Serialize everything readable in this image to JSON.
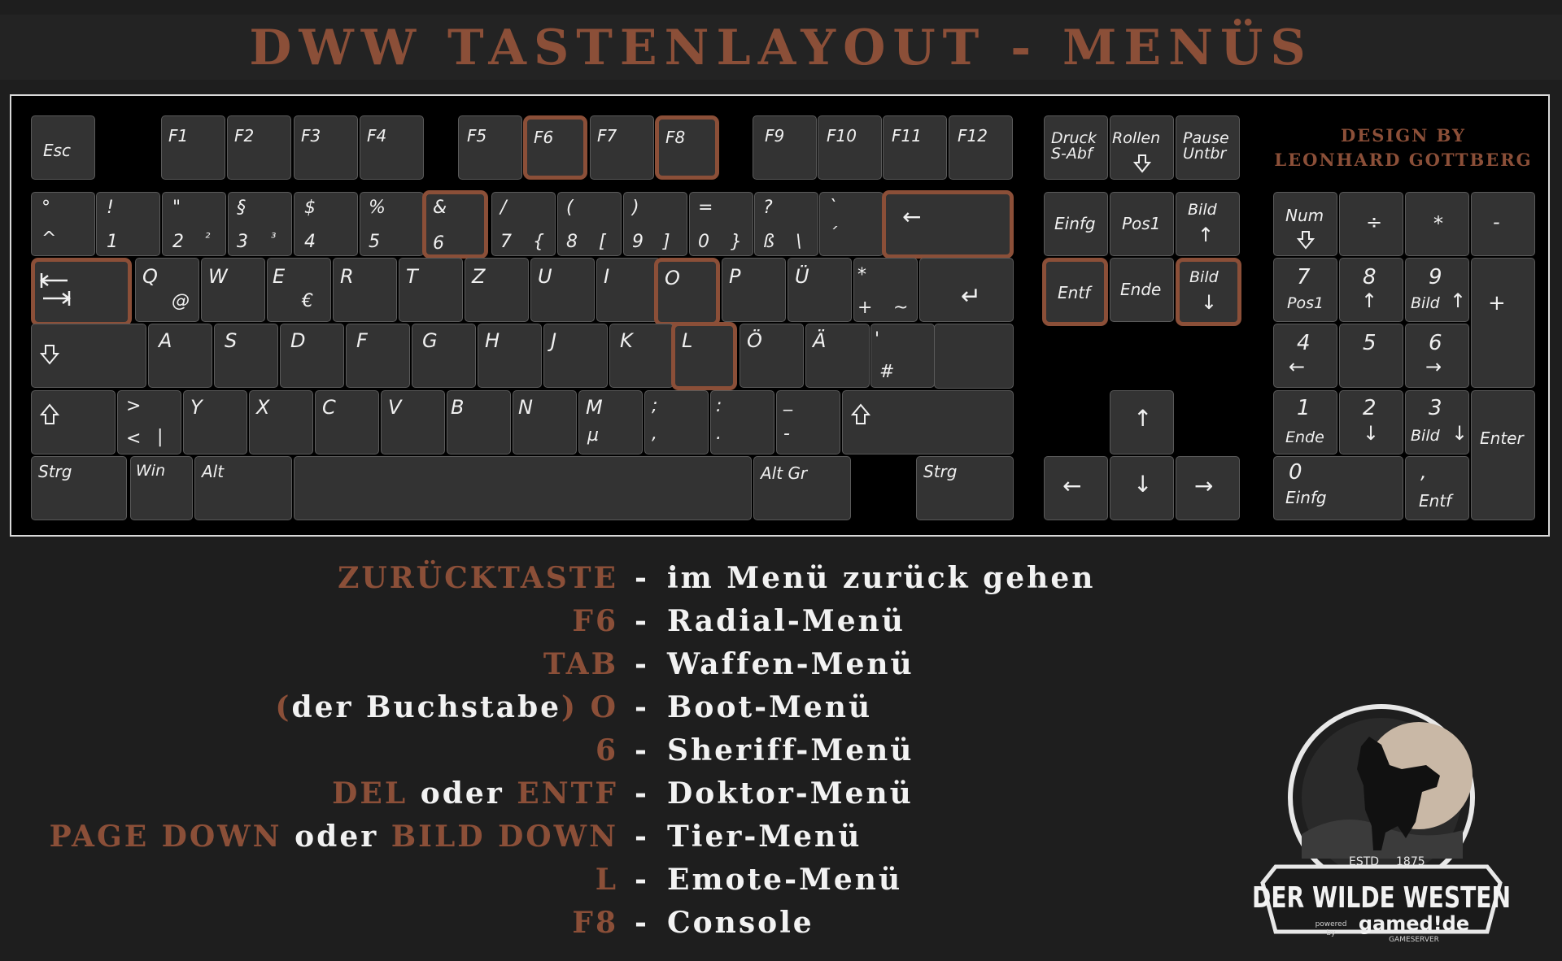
{
  "title": "DWW TASTENLAYOUT - MENÜS",
  "design_by": {
    "line1": "DESIGN BY",
    "line2": "LEONHARD GOTTBERG"
  },
  "colors": {
    "accent": "#8b4f38",
    "key": "#333333",
    "background": "#1e1e1e",
    "text": "#f2f2f2"
  },
  "keys": {
    "esc": "Esc",
    "f1": "F1",
    "f2": "F2",
    "f3": "F3",
    "f4": "F4",
    "f5": "F5",
    "f6": "F6",
    "f7": "F7",
    "f8": "F8",
    "f9": "F9",
    "f10": "F10",
    "f11": "F11",
    "f12": "F12",
    "druck": "Druck\nS-Abf",
    "rollen": "Rollen",
    "pause": "Pause\nUntbr",
    "deg_top": "°",
    "deg_bot": "^",
    "n1_top": "!",
    "n1_bot": "1",
    "n2_top": "\"",
    "n2_bot": "2",
    "n2_alt": "²",
    "n3_top": "§",
    "n3_bot": "3",
    "n3_alt": "³",
    "n4_top": "$",
    "n4_bot": "4",
    "n5_top": "%",
    "n5_bot": "5",
    "n6_top": "&",
    "n6_bot": "6",
    "n7_top": "/",
    "n7_bot": "7",
    "n7_alt": "{",
    "n8_top": "(",
    "n8_bot": "8",
    "n8_alt": "[",
    "n9_top": ")",
    "n9_bot": "9",
    "n9_alt": "]",
    "n0_top": "=",
    "n0_bot": "0",
    "n0_alt": "}",
    "sz_top": "?",
    "sz_bot": "ß",
    "sz_alt": "\\",
    "acc_top": "`",
    "acc_bot": "´",
    "backspace": "←",
    "q": "Q",
    "q_alt": "@",
    "w": "W",
    "e": "E",
    "e_alt": "€",
    "r": "R",
    "t": "T",
    "z": "Z",
    "u": "U",
    "i": "I",
    "o": "O",
    "p": "P",
    "ue": "Ü",
    "plus_top": "*",
    "plus_bot": "+",
    "plus_alt": "~",
    "enter": "↵",
    "a": "A",
    "s": "S",
    "d": "D",
    "f": "F",
    "g": "G",
    "h": "H",
    "j": "J",
    "k": "K",
    "l": "L",
    "oe": "Ö",
    "ae": "Ä",
    "hash_top": "'",
    "hash_bot": "#",
    "lt_top": ">",
    "lt_bot": "<",
    "lt_alt": "|",
    "y": "Y",
    "x": "X",
    "c": "C",
    "v": "V",
    "b": "B",
    "n": "N",
    "m": "M",
    "m_alt": "µ",
    "comma_top": ";",
    "comma_bot": ",",
    "dot_top": ":",
    "dot_bot": ".",
    "minus_top": "_",
    "minus_bot": "-",
    "strg": "Strg",
    "win": "Win",
    "alt": "Alt",
    "altgr": "Alt Gr",
    "strg_r": "Strg",
    "einfg": "Einfg",
    "pos1": "Pos1",
    "bild_up": "Bild",
    "entf": "Entf",
    "ende": "Ende",
    "bild_down": "Bild",
    "arrow_up": "↑",
    "arrow_left": "←",
    "arrow_down": "↓",
    "arrow_right": "→",
    "num": "Num",
    "np_div": "÷",
    "np_mul": "*",
    "np_minus": "-",
    "np_plus": "+",
    "np7": "7",
    "np7_sub": "Pos1",
    "np8": "8",
    "np9": "9",
    "np9_sub": "Bild",
    "np4": "4",
    "np5": "5",
    "np6": "6",
    "np1": "1",
    "np1_sub": "Ende",
    "np2": "2",
    "np3": "3",
    "np3_sub": "Bild",
    "np0": "0",
    "np0_sub": "Einfg",
    "npdot": "‚",
    "npdot_sub": "Entf",
    "np_enter": "Enter"
  },
  "mappings": [
    {
      "key": "ZURÜCKTASTE",
      "desc": "im Menü zurück gehen"
    },
    {
      "key": "F6",
      "desc": "Radial-Menü"
    },
    {
      "key": "TAB",
      "desc": "Waffen-Menü"
    },
    {
      "pre_a": "(",
      "pre_b": "der Buchstabe",
      "pre_c": ")",
      "key": "O",
      "desc": "Boot-Menü"
    },
    {
      "key": "6",
      "desc": "Sheriff-Menü"
    },
    {
      "key": "DEL",
      "mid": "oder",
      "key2": "ENTF",
      "desc": "Doktor-Menü"
    },
    {
      "key": "PAGE DOWN",
      "mid": "oder",
      "key2": "BILD DOWN",
      "desc": "Tier-Menü"
    },
    {
      "key": "L",
      "desc": "Emote-Menü"
    },
    {
      "key": "F8",
      "desc": "Console"
    }
  ],
  "dash": "-",
  "logo": {
    "estd": "ESTD",
    "year": "1875",
    "name": "DER WILDE WESTEN",
    "powered": "powered",
    "by": "by",
    "brand": "gamed!de",
    "sub": "GAMESERVER"
  }
}
